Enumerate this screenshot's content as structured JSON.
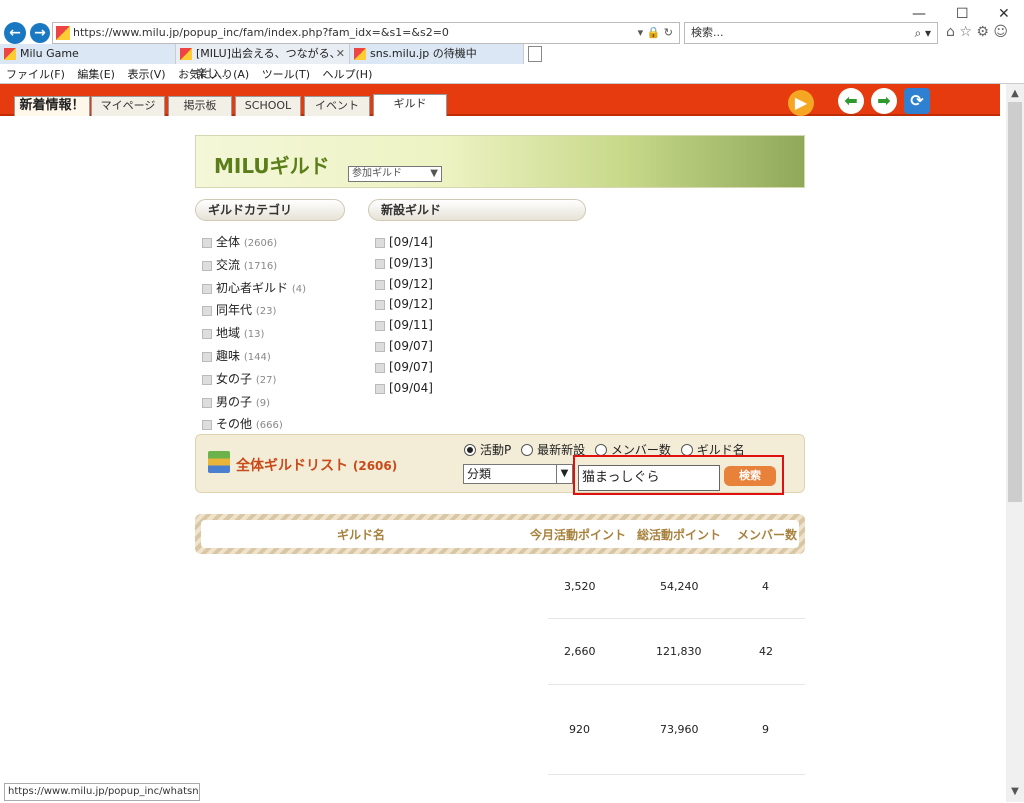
{
  "browser": {
    "url": "https://www.milu.jp/popup_inc/fam/index.php?fam_idx=&s1=&s2=0",
    "search_placeholder": "検索...",
    "tabs": [
      {
        "label": "Milu Game"
      },
      {
        "label": "[MILU]出会える、つながる、楽し...",
        "close": "✕"
      },
      {
        "label": "sns.milu.jp の待機中"
      }
    ],
    "menu": [
      "ファイル(F)",
      "編集(E)",
      "表示(V)",
      "お気に入り(A)",
      "ツール(T)",
      "ヘルプ(H)"
    ],
    "status_url": "https://www.milu.jp/popup_inc/whatsnew"
  },
  "site_tabs": [
    "新着情報！",
    "マイページ",
    "掲示板",
    "SCHOOL",
    "イベント",
    "ギルド"
  ],
  "banner": {
    "title": "MILUギルド",
    "select": "参加ギルド"
  },
  "category": {
    "header": "ギルドカテゴリ",
    "items": [
      {
        "label": "全体",
        "count": "(2606)"
      },
      {
        "label": "交流",
        "count": "(1716)"
      },
      {
        "label": "初心者ギルド",
        "count": "(4)"
      },
      {
        "label": "同年代",
        "count": "(23)"
      },
      {
        "label": "地域",
        "count": "(13)"
      },
      {
        "label": "趣味",
        "count": "(144)"
      },
      {
        "label": "女の子",
        "count": "(27)"
      },
      {
        "label": "男の子",
        "count": "(9)"
      },
      {
        "label": "その他",
        "count": "(666)"
      }
    ]
  },
  "new_guild": {
    "header": "新設ギルド",
    "items": [
      "[09/14]",
      "[09/13]",
      "[09/12]",
      "[09/12]",
      "[09/11]",
      "[09/07]",
      "[09/07]",
      "[09/04]"
    ]
  },
  "guild_list": {
    "title": "全体ギルドリスト",
    "count": "(2606)",
    "radios": [
      "活動P",
      "最新新設",
      "メンバー数",
      "ギルド名"
    ],
    "selected_radio": "活動P",
    "category_select": "分類",
    "keyword": "猫まっしぐら",
    "search_button": "検索"
  },
  "table": {
    "headers": [
      "ギルド名",
      "今月活動ポイント",
      "総活動ポイント",
      "メンバー数"
    ],
    "rows": [
      {
        "month": "3,520",
        "total": "54,240",
        "members": "4"
      },
      {
        "month": "2,660",
        "total": "121,830",
        "members": "42"
      },
      {
        "month": "920",
        "total": "73,960",
        "members": "9"
      }
    ]
  }
}
